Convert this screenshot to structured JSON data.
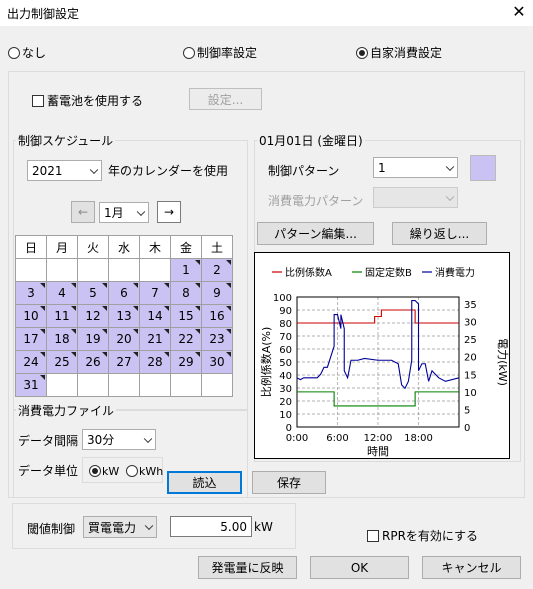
{
  "window": {
    "title": "出力制御設定",
    "close": "✕"
  },
  "mode": {
    "none": "なし",
    "rate": "制御率設定",
    "self": "自家消費設定",
    "selected": "self"
  },
  "battery": {
    "label": "蓄電池を使用する",
    "settings_button": "設定..."
  },
  "schedule": {
    "group_label": "制御スケジュール",
    "year": "2021",
    "year_suffix": "年のカレンダーを使用",
    "month": "1月",
    "prev": "←",
    "next": "→",
    "weekdays": [
      "日",
      "月",
      "火",
      "水",
      "木",
      "金",
      "土"
    ],
    "rows": [
      [
        "",
        "",
        "",
        "",
        "",
        "1",
        "2"
      ],
      [
        "3",
        "4",
        "5",
        "6",
        "7",
        "8",
        "9"
      ],
      [
        "10",
        "11",
        "12",
        "13",
        "14",
        "15",
        "16"
      ],
      [
        "17",
        "18",
        "19",
        "20",
        "21",
        "22",
        "23"
      ],
      [
        "24",
        "25",
        "26",
        "27",
        "28",
        "29",
        "30"
      ],
      [
        "31",
        "",
        "",
        "",
        "",
        "",
        ""
      ]
    ]
  },
  "day_panel": {
    "date_label": "01月01日 (金曜日)",
    "pattern_label": "制御パターン",
    "pattern_value": "1",
    "pattern_color": "#c9c2f2",
    "consumption_pattern_label": "消費電力パターン",
    "consumption_pattern_value": "",
    "edit_pattern_button": "パターン編集...",
    "repeat_button": "繰り返し..."
  },
  "consumption_file": {
    "group_label": "消費電力ファイル",
    "interval_label": "データ間隔",
    "interval_value": "30分",
    "unit_label": "データ単位",
    "unit_kw": "kW",
    "unit_kwh": "kWh",
    "unit_selected": "kW",
    "load_button": "読込",
    "save_button": "保存"
  },
  "threshold": {
    "label": "閾値制御",
    "select_value": "買電電力",
    "value": "5.00",
    "unit": "kW",
    "rpr_label": "RPRを有効にする"
  },
  "footer": {
    "reflect_button": "発電量に反映",
    "ok_button": "OK",
    "cancel_button": "キャンセル"
  },
  "chart_data": {
    "type": "line",
    "legend": [
      "比例係数A",
      "固定定数B",
      "消費電力"
    ],
    "colors": {
      "a": "#cc0000",
      "b": "#008000",
      "power": "#000099"
    },
    "xlabel": "時間",
    "ylabel_left": "比例係数A(%)",
    "ylabel_right": "電力(kW)",
    "x_ticks": [
      "0:00",
      "6:00",
      "12:00",
      "18:00"
    ],
    "y_left_ticks": [
      "0",
      "10",
      "20",
      "30",
      "40",
      "50",
      "60",
      "70",
      "80",
      "90",
      "100"
    ],
    "y_right_ticks": [
      "0",
      "5",
      "10",
      "15",
      "20",
      "25",
      "30",
      "35"
    ],
    "xlim": [
      0,
      24
    ],
    "ylim_left": [
      0,
      100
    ],
    "ylim_right": [
      0,
      37
    ],
    "series": [
      {
        "name": "比例係数A",
        "axis": "left",
        "x": [
          0,
          11.5,
          11.5,
          12.5,
          12.5,
          17.5,
          17.5,
          24
        ],
        "y": [
          80,
          80,
          85,
          85,
          90,
          90,
          80,
          80
        ]
      },
      {
        "name": "固定定数B",
        "axis": "right",
        "x": [
          0,
          5.5,
          5.5,
          17.5,
          17.5,
          24
        ],
        "y": [
          10,
          10,
          6,
          6,
          10,
          10
        ]
      },
      {
        "name": "消費電力",
        "axis": "right",
        "x": [
          0,
          0.5,
          1,
          3,
          3.5,
          4,
          4.5,
          5,
          5.5,
          5.5,
          6,
          6.5,
          6.5,
          7,
          7,
          7.5,
          8,
          9,
          10,
          12,
          14,
          15,
          15.5,
          16,
          16.5,
          17,
          17,
          17.5,
          18,
          18,
          18.5,
          19,
          19.5,
          20,
          21,
          22,
          24
        ],
        "y": [
          14,
          13.5,
          14,
          14,
          15,
          17,
          17,
          20,
          23,
          32,
          32,
          28,
          32,
          28,
          16,
          14,
          19,
          19,
          19.5,
          19,
          19,
          18,
          12,
          11,
          13,
          19,
          36,
          36,
          35,
          16,
          18,
          18,
          13,
          16,
          14,
          13,
          14
        ]
      }
    ]
  }
}
